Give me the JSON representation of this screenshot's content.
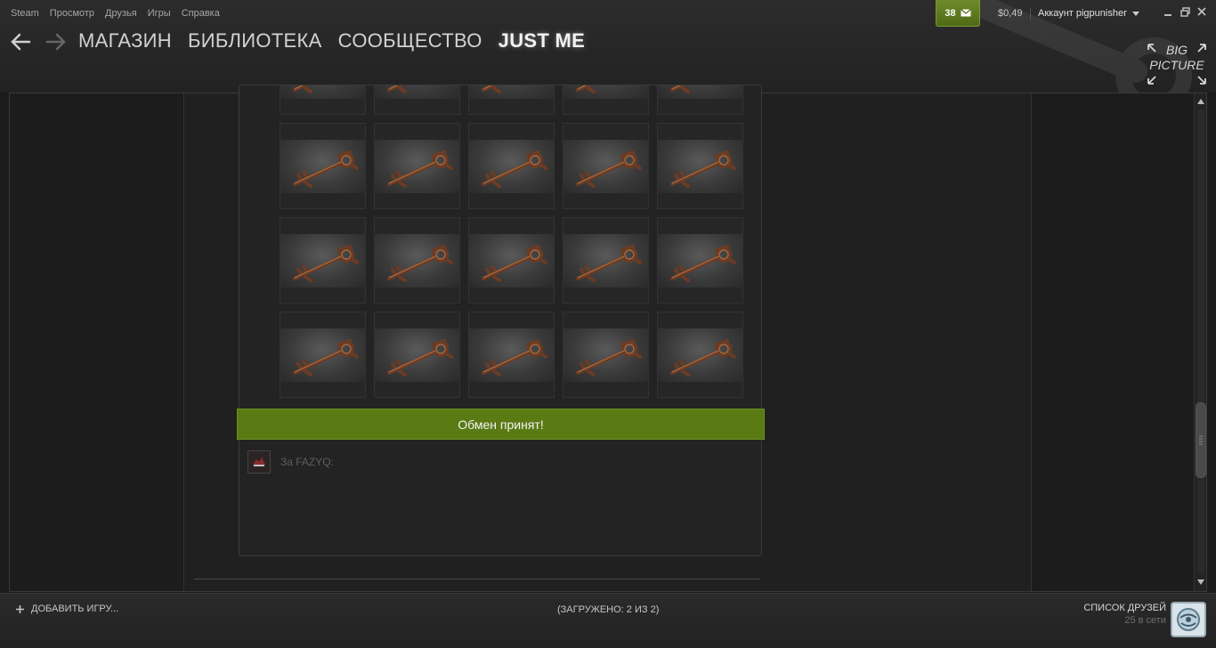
{
  "menu": [
    "Steam",
    "Просмотр",
    "Друзья",
    "Игры",
    "Справка"
  ],
  "nav": {
    "tabs": [
      "МАГАЗИН",
      "БИБЛИОТЕКА",
      "СООБЩЕСТВО",
      "JUST ME"
    ],
    "active_index": 3
  },
  "notifications": {
    "count": "38",
    "icon": "envelope-icon"
  },
  "wallet": "$0,49",
  "account": "Аккаунт pigpunisher",
  "big_picture": {
    "line1": "BIG",
    "line2": "PICTURE"
  },
  "trade": {
    "items_rows": 4,
    "items_cols": 5,
    "item_icon": "key-icon",
    "status_text": "Обмен принят!",
    "for_label": "За FAZYQ:",
    "status_color": "#5a7a14"
  },
  "bottom": {
    "add_game": "ДОБАВИТЬ ИГРУ...",
    "loaded": "(ЗАГРУЖЕНО: 2 ИЗ 2)",
    "friends_title": "СПИСОК ДРУЗЕЙ",
    "friends_online": "25 в сети"
  }
}
